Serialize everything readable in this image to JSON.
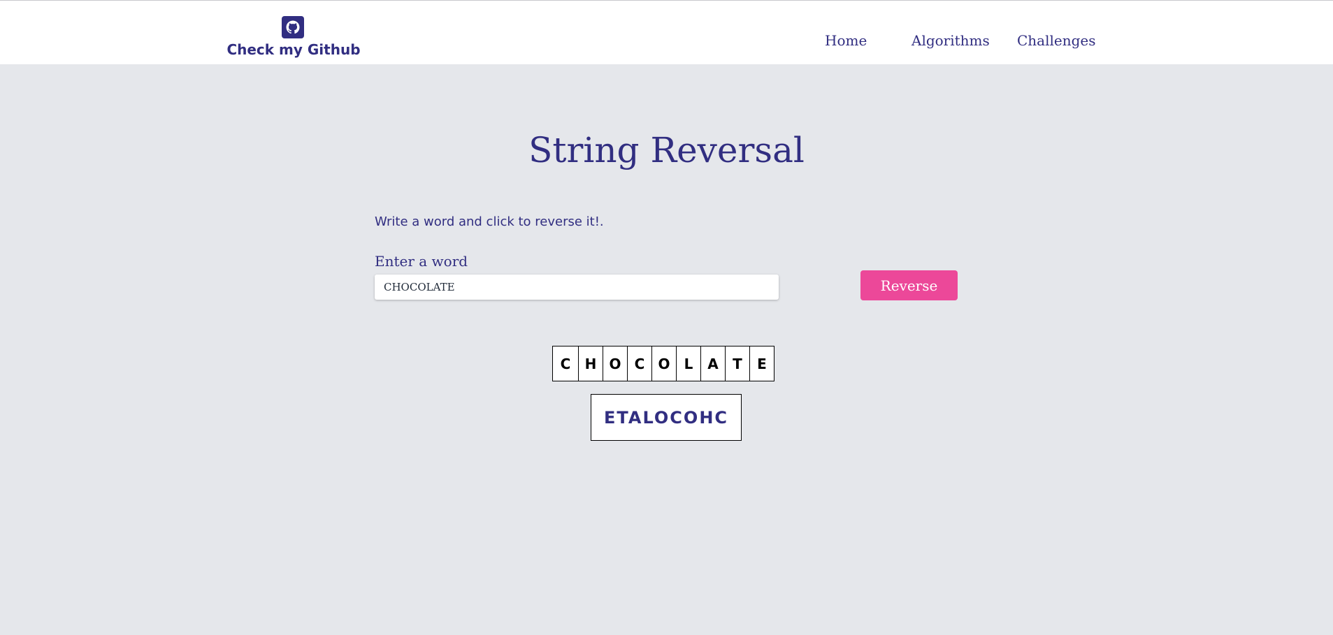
{
  "nav": {
    "brand_label": "Check my Github",
    "brand_icon": "github-icon",
    "links": [
      {
        "label": "Home"
      },
      {
        "label": "Algorithms"
      },
      {
        "label": "Challenges"
      }
    ]
  },
  "main": {
    "title": "String Reversal",
    "instructions": "Write a word and click to reverse it!.",
    "input_label": "Enter a word",
    "input_value": "CHOCOLATE",
    "button_label": "Reverse",
    "letters": [
      "C",
      "H",
      "O",
      "C",
      "O",
      "L",
      "A",
      "T",
      "E"
    ],
    "result": "ETALOCOHC"
  },
  "colors": {
    "background": "#e5e7eb",
    "primary_text": "#312e81",
    "button": "#ec4899",
    "navbar": "#ffffff"
  }
}
